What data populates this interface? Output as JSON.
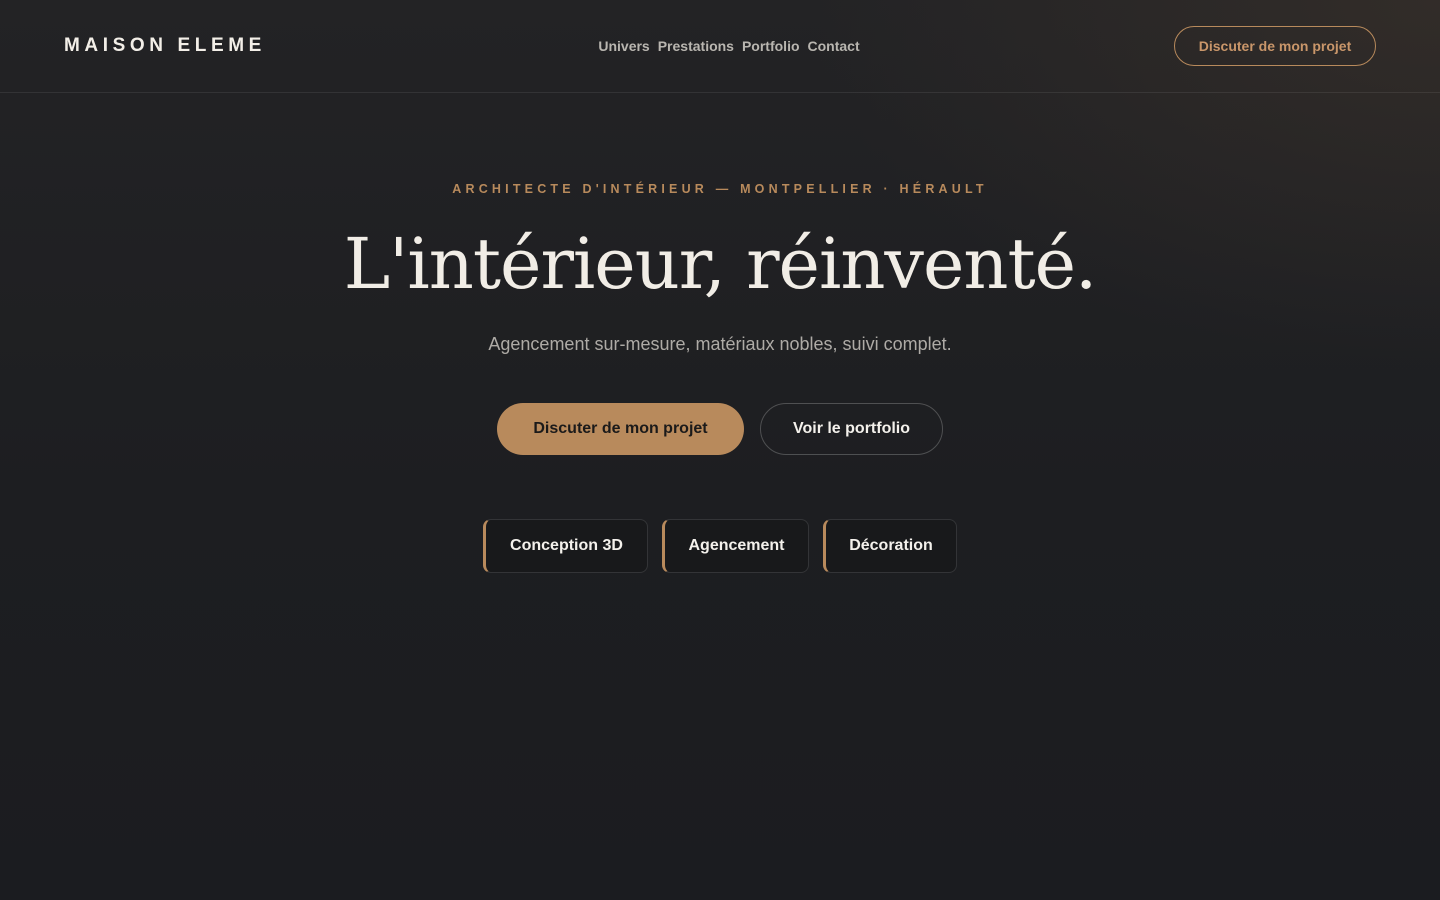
{
  "header": {
    "brand": "MAISON ELEME",
    "nav": [
      "Univers",
      "Prestations",
      "Portfolio",
      "Contact"
    ],
    "cta_label": "Discuter de mon projet"
  },
  "hero": {
    "eyebrow": "ARCHITECTE D'INTÉRIEUR — MONTPELLIER · HÉRAULT",
    "title": "L'intérieur, réinventé.",
    "subtitle": "Agencement sur-mesure, matériaux nobles, suivi complet.",
    "primary_cta": "Discuter de mon projet",
    "secondary_cta": "Voir le portfolio"
  },
  "services": [
    "Conception 3D",
    "Agencement",
    "Décoration"
  ],
  "colors": {
    "accent": "#b88a5c",
    "background": "#1c1d20",
    "text": "#f1ede6",
    "muted": "#aeaba6"
  }
}
